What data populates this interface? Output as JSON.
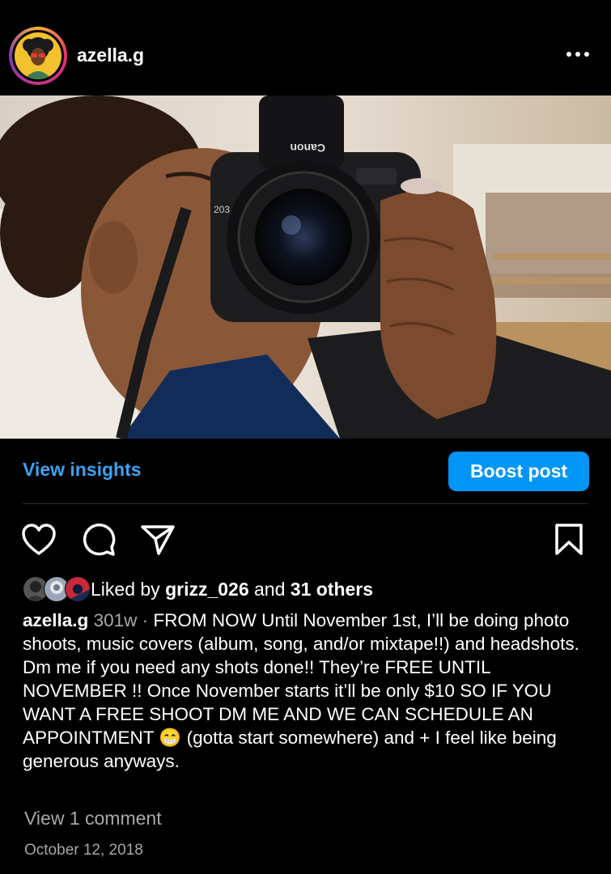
{
  "post": {
    "username": "azella.g",
    "insights_label": "View insights",
    "boost_label": "Boost post",
    "liked_prefix": "Liked by ",
    "liked_user": "grizz_026",
    "liked_and": " and ",
    "liked_others": "31 others",
    "caption_user": "azella.g",
    "caption_age": "301w",
    "caption_sep": " · ",
    "caption_text": "FROM NOW Until November 1st, I’ll be doing photo shoots, music covers (album, song, and/or mixtape!!) and headshots. Dm me if you need any shots done!! They’re FREE UNTIL NOVEMBER !! Once November starts it’ll be only $10 SO IF YOU WANT A FREE SHOOT DM ME AND WE CAN SCHEDULE AN APPOINTMENT 😁 (gotta start somewhere) and + I feel like being generous anyways.",
    "view_comments": "View 1 comment",
    "date": "October 12, 2018"
  },
  "icons": [
    "more-icon",
    "heart-icon",
    "comment-icon",
    "share-icon",
    "bookmark-icon"
  ],
  "colors": {
    "link": "#3aa3f5",
    "boost": "#0095f6",
    "muted": "#a8a8a8",
    "background": "#000000"
  }
}
